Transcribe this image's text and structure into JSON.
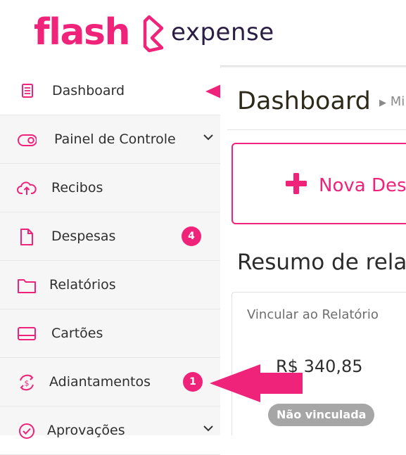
{
  "header": {
    "logo_primary": "flash",
    "logo_secondary": "expense",
    "brand_color": "#f0237a",
    "logo_icon": "flash-brand-icon"
  },
  "sidebar": {
    "items": [
      {
        "label": "Dashboard",
        "icon": "list-document-icon",
        "active": true
      },
      {
        "label": "Painel de Controle",
        "icon": "toggle-icon",
        "has_chevron": true
      },
      {
        "label": "Recibos",
        "icon": "cloud-upload-icon"
      },
      {
        "label": "Despesas",
        "icon": "file-icon",
        "badge": "4"
      },
      {
        "label": "Relatórios",
        "icon": "folder-icon"
      },
      {
        "label": "Cartões",
        "icon": "credit-card-icon"
      },
      {
        "label": "Adiantamentos",
        "icon": "dollar-cycle-icon",
        "badge": "1"
      },
      {
        "label": "Aprovações",
        "icon": "check-circle-icon",
        "has_chevron": true
      }
    ]
  },
  "main": {
    "title": "Dashboard",
    "breadcrumb": "Mi",
    "new_expense_label": "Nova Desp",
    "summary_title": "Resumo de relat",
    "card": {
      "label": "Vincular ao Relatório",
      "amount": "R$ 340,85",
      "status": "Não vinculada"
    }
  }
}
